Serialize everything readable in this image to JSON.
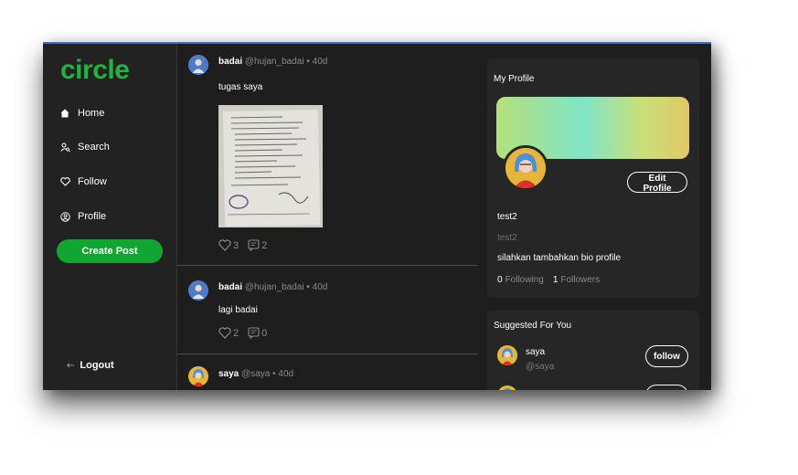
{
  "sidebar": {
    "logo": "circle",
    "items": [
      {
        "label": "Home",
        "icon": "home-icon"
      },
      {
        "label": "Search",
        "icon": "search-user-icon"
      },
      {
        "label": "Follow",
        "icon": "heart-icon"
      },
      {
        "label": "Profile",
        "icon": "profile-icon"
      }
    ],
    "create_label": "Create Post",
    "logout_label": "Logout"
  },
  "feed": {
    "posts": [
      {
        "name": "badai",
        "handle": "@hujan_badai",
        "age": "40d",
        "text": "tugas saya",
        "likes": "3",
        "replies": "2",
        "has_image": true
      },
      {
        "name": "badai",
        "handle": "@hujan_badai",
        "age": "40d",
        "text": "lagi badai",
        "likes": "2",
        "replies": "0"
      },
      {
        "name": "saya",
        "handle": "@saya",
        "age": "40d"
      }
    ],
    "separator": "•"
  },
  "profile": {
    "title": "My Profile",
    "edit_label": "Edit Profile",
    "name": "test2",
    "username": "test2",
    "bio": "silahkan tambahkan bio profile",
    "following_count": "0",
    "following_label": "Following",
    "followers_count": "1",
    "followers_label": "Followers"
  },
  "suggested": {
    "title": "Suggested For You",
    "users": [
      {
        "name": "saya",
        "handle": "@saya",
        "button": "follow"
      }
    ]
  },
  "colors": {
    "accent_green": "#11a631",
    "logo_green": "#1fb43f",
    "background": "#1e1e1e",
    "card": "#262626",
    "muted": "#8a8a8a"
  }
}
